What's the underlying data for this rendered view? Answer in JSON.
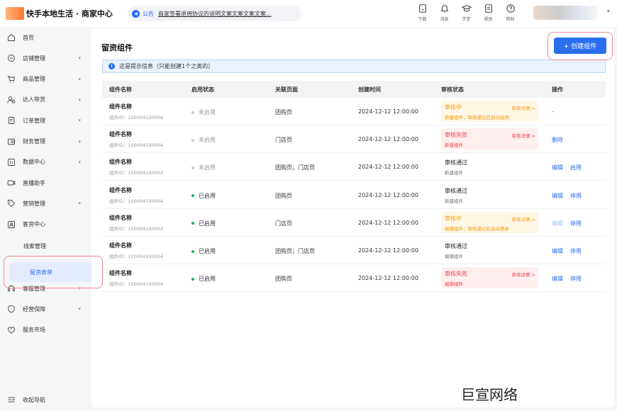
{
  "header": {
    "brand": "快手本地生活 · 商家中心",
    "notice_tag": "公告",
    "notice_text": "商家签署退佣协议的说明文案文案文案文案...",
    "tools": [
      {
        "icon": "download-icon",
        "label": "下载"
      },
      {
        "icon": "bell-icon",
        "label": "消息"
      },
      {
        "icon": "graduation-cap-icon",
        "label": "学堂"
      },
      {
        "icon": "rules-icon",
        "label": "规则"
      },
      {
        "icon": "help-icon",
        "label": "帮助"
      }
    ]
  },
  "sidebar": {
    "items": [
      {
        "label": "首页",
        "icon": "home-icon",
        "has_caret": false
      },
      {
        "label": "店铺管理",
        "icon": "store-icon",
        "has_caret": true
      },
      {
        "label": "商品管理",
        "icon": "cart-icon",
        "has_caret": true
      },
      {
        "label": "达人带货",
        "icon": "users-icon",
        "has_caret": true
      },
      {
        "label": "订单管理",
        "icon": "order-icon",
        "has_caret": true
      },
      {
        "label": "财务管理",
        "icon": "wallet-icon",
        "has_caret": true
      },
      {
        "label": "数据中心",
        "icon": "chart-icon",
        "has_caret": true
      },
      {
        "label": "直播助手",
        "icon": "video-icon",
        "has_caret": false
      },
      {
        "label": "营销管理",
        "icon": "tag-icon",
        "has_caret": true
      },
      {
        "label": "客资中心",
        "icon": "contacts-icon",
        "has_caret": false
      }
    ],
    "sub_items": [
      "线索管理"
    ],
    "active_item": "留资表单",
    "items_after": [
      {
        "label": "客服管理",
        "icon": "headset-icon",
        "has_caret": true
      },
      {
        "label": "经营保障",
        "icon": "shield-icon",
        "has_caret": true
      },
      {
        "label": "服务市场",
        "icon": "heart-icon",
        "has_caret": false
      }
    ],
    "collapse_label": "收起导航"
  },
  "main": {
    "title": "留资组件",
    "create_button": "+ 创建组件",
    "tip": "这是提示信息（只能创建1个之类的）",
    "columns": [
      "组件名称",
      "启用状态",
      "关联页面",
      "创建时间",
      "审核状态",
      "操作"
    ],
    "rows": [
      {
        "name": "组件名称",
        "id": "组件ID：100004100004",
        "status": "未启用",
        "enabled": false,
        "page": "团购页",
        "time": "2024-12-12 12:00:00",
        "audit": "审核中",
        "audit_type": "pending",
        "audit_detail": "审核详情 >",
        "audit_sub": "新建组件，审核通过后自动启用",
        "ops": [
          {
            "label": "-",
            "kind": "none"
          }
        ]
      },
      {
        "name": "组件名称",
        "id": "组件ID：100004100004",
        "status": "未启用",
        "enabled": false,
        "page": "门店页",
        "time": "2024-12-12 12:00:00",
        "audit": "审核失败",
        "audit_type": "failed",
        "audit_detail": "审核详情 >",
        "audit_sub": "新建组件",
        "ops": [
          {
            "label": "删除",
            "kind": "link"
          }
        ]
      },
      {
        "name": "组件名称",
        "id": "组件ID：100004100004",
        "status": "未启用",
        "enabled": false,
        "page": "团购页；门店页",
        "time": "2024-12-12 12:00:00",
        "audit": "审核通过",
        "audit_type": "passed",
        "audit_detail": "",
        "audit_sub": "新建组件",
        "ops": [
          {
            "label": "编辑",
            "kind": "link"
          },
          {
            "label": "启用",
            "kind": "link"
          }
        ]
      },
      {
        "name": "组件名称",
        "id": "组件ID：100004100004",
        "status": "已启用",
        "enabled": true,
        "page": "团购页",
        "time": "2024-12-12 12:00:00",
        "audit": "审核通过",
        "audit_type": "passed",
        "audit_detail": "",
        "audit_sub": "新建组件",
        "ops": [
          {
            "label": "编辑",
            "kind": "link"
          },
          {
            "label": "停用",
            "kind": "link"
          }
        ]
      },
      {
        "name": "组件名称",
        "id": "组件ID：100004100004",
        "status": "已启用",
        "enabled": true,
        "page": "门店页",
        "time": "2024-12-12 12:00:00",
        "audit": "审核中",
        "audit_type": "pending",
        "audit_detail": "审核详情 >",
        "audit_sub": "编辑组件，审核通过后自动更新",
        "ops": [
          {
            "label": "编辑",
            "kind": "disabled"
          },
          {
            "label": "停用",
            "kind": "link"
          }
        ]
      },
      {
        "name": "组件名称",
        "id": "组件ID：100004100004",
        "status": "已启用",
        "enabled": true,
        "page": "团购页；门店页",
        "time": "2024-12-12 12:00:00",
        "audit": "审核通过",
        "audit_type": "passed",
        "audit_detail": "",
        "audit_sub": "编辑组件",
        "ops": [
          {
            "label": "编辑",
            "kind": "link"
          },
          {
            "label": "停用",
            "kind": "link"
          }
        ]
      },
      {
        "name": "组件名称",
        "id": "组件ID：100004100004",
        "status": "已启用",
        "enabled": true,
        "page": "团购页",
        "time": "2024-12-12 12:00:00",
        "audit": "审核失败",
        "audit_type": "failed",
        "audit_detail": "审核详情 >",
        "audit_sub": "编辑组件",
        "ops": [
          {
            "label": "编辑",
            "kind": "link"
          },
          {
            "label": "停用",
            "kind": "link"
          }
        ]
      }
    ]
  },
  "watermark": "巨宣网络",
  "colors": {
    "primary": "#2a6ef0",
    "pending": "#f59a0c",
    "failed": "#e8464c",
    "enabled_dot": "#20b55a",
    "disabled_dot": "#c4c7cc"
  }
}
